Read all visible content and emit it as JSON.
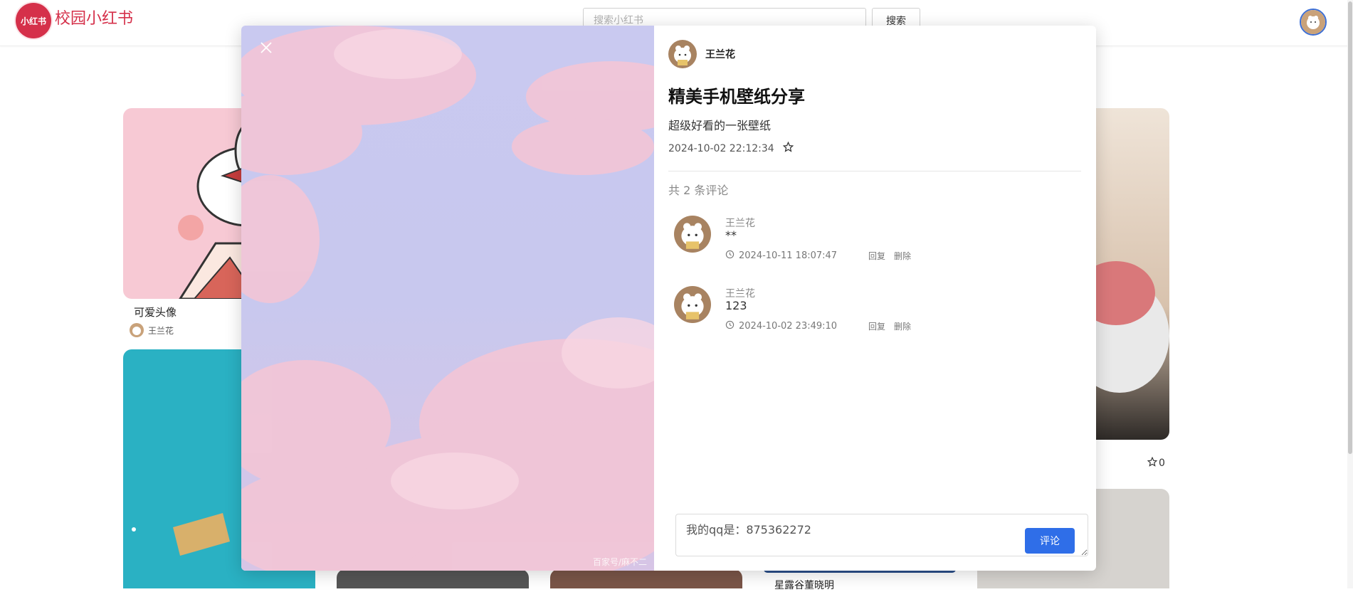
{
  "header": {
    "logo_text": "小红书",
    "app_title": "校园小红书",
    "search_placeholder": "搜索小红书",
    "search_button": "搜索"
  },
  "feed": {
    "cards": [
      {
        "title": "可爱头像",
        "author": "王兰花"
      },
      {
        "title": "星露谷董晓明",
        "author": ""
      }
    ],
    "right_card_likes": "0"
  },
  "modal": {
    "author_name": "王兰花",
    "title": "精美手机壁纸分享",
    "description": "超级好看的一张壁纸",
    "date": "2024-10-02 22:12:34",
    "comment_count_label": "共 2 条评论",
    "watermark": "百家号/麻不二",
    "comments": [
      {
        "name": "王兰花",
        "text": "**",
        "time": "2024-10-11 18:07:47",
        "reply": "回复",
        "delete": "删除"
      },
      {
        "name": "王兰花",
        "text": "123",
        "time": "2024-10-02 23:49:10",
        "reply": "回复",
        "delete": "删除"
      }
    ],
    "comment_input_value": "我的qq是：875362272",
    "submit_label": "评论"
  },
  "icons": {
    "close": "close-icon",
    "star": "star-icon",
    "clock": "clock-icon"
  },
  "colors": {
    "brand": "#d5304a",
    "primary_button": "#2f6ee8"
  }
}
